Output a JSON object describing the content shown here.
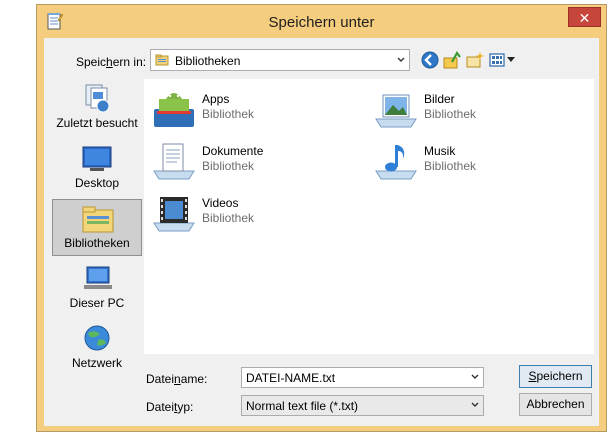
{
  "window": {
    "title": "Speichern unter",
    "close_glyph": "✕"
  },
  "toolbar": {
    "save_in_label_pre": "Speic",
    "save_in_label_accel": "h",
    "save_in_label_post": "ern in:",
    "location": "Bibliotheken",
    "buttons": [
      "back-icon",
      "up-folder-icon",
      "new-folder-icon",
      "view-menu-icon"
    ]
  },
  "places": [
    {
      "label": "Zuletzt besucht",
      "icon": "recent-places-icon"
    },
    {
      "label": "Desktop",
      "icon": "desktop-icon"
    },
    {
      "label": "Bibliotheken",
      "icon": "libraries-icon",
      "selected": true
    },
    {
      "label": "Dieser PC",
      "icon": "this-pc-icon"
    },
    {
      "label": "Netzwerk",
      "icon": "network-icon"
    }
  ],
  "items": [
    {
      "name": "Apps",
      "type": "Bibliothek",
      "icon": "apps-library-icon"
    },
    {
      "name": "Bilder",
      "type": "Bibliothek",
      "icon": "pictures-library-icon"
    },
    {
      "name": "Dokumente",
      "type": "Bibliothek",
      "icon": "documents-library-icon"
    },
    {
      "name": "Musik",
      "type": "Bibliothek",
      "icon": "music-library-icon"
    },
    {
      "name": "Videos",
      "type": "Bibliothek",
      "icon": "videos-library-icon"
    }
  ],
  "form": {
    "filename_label_pre": "Datei",
    "filename_label_accel": "n",
    "filename_label_post": "ame:",
    "filename_value": "DATEI-NAME.txt",
    "filetype_label_pre": "Datei",
    "filetype_label_accel": "t",
    "filetype_label_post": "yp:",
    "filetype_value": "Normal text file (*.txt)"
  },
  "buttons": {
    "save_accel": "S",
    "save_rest": "peichern",
    "cancel": "Abbrechen"
  },
  "colors": {
    "frame": "#f5cd7e",
    "close": "#c7463b",
    "accent": "#3c7fb1"
  }
}
